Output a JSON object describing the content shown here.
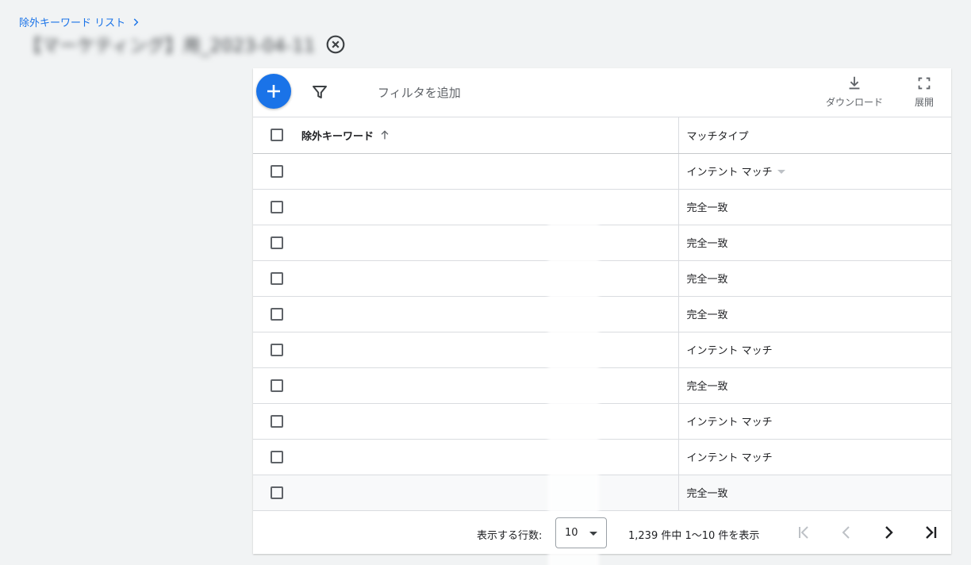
{
  "breadcrumb": {
    "label": "除外キーワード リスト"
  },
  "page": {
    "title": "【マーケティング】用_2023-04-11"
  },
  "toolbar": {
    "filter_placeholder": "フィルタを追加",
    "download_label": "ダウンロード",
    "expand_label": "展開"
  },
  "table": {
    "headers": {
      "keyword": "除外キーワード",
      "match_type": "マッチタイプ"
    },
    "rows": [
      {
        "keyword": "",
        "match_type": "インテント マッチ",
        "has_dropdown": true
      },
      {
        "keyword": "",
        "match_type": "完全一致"
      },
      {
        "keyword": "",
        "match_type": "完全一致"
      },
      {
        "keyword": "",
        "match_type": "完全一致"
      },
      {
        "keyword": "",
        "match_type": "完全一致"
      },
      {
        "keyword": "",
        "match_type": "インテント マッチ"
      },
      {
        "keyword": "",
        "match_type": "完全一致"
      },
      {
        "keyword": "",
        "match_type": "インテント マッチ"
      },
      {
        "keyword": "",
        "match_type": "インテント マッチ"
      },
      {
        "keyword": "",
        "match_type": "完全一致"
      }
    ]
  },
  "pagination": {
    "rows_label": "表示する行数:",
    "rows_value": "10",
    "range_text": "1,239 件中 1〜10 件を表示"
  },
  "colors": {
    "accent": "#1a73e8",
    "background": "#f1f3f4"
  }
}
